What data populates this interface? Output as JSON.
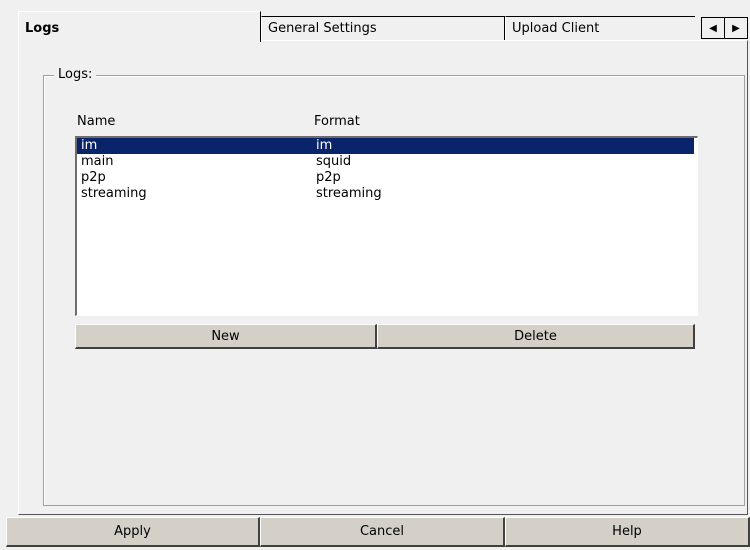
{
  "tabs": [
    {
      "label": "Logs",
      "active": true
    },
    {
      "label": "General Settings",
      "active": false
    },
    {
      "label": "Upload Client",
      "active": false
    }
  ],
  "tab_scroll": {
    "left": "◀",
    "right": "▶"
  },
  "group": {
    "label": "Logs:"
  },
  "columns": {
    "name": "Name",
    "format": "Format"
  },
  "rows": [
    {
      "name": "im",
      "format": "im",
      "selected": true
    },
    {
      "name": "main",
      "format": "squid"
    },
    {
      "name": "p2p",
      "format": "p2p"
    },
    {
      "name": "streaming",
      "format": "streaming"
    }
  ],
  "buttons": {
    "new": "New",
    "delete": "Delete"
  },
  "footer": {
    "apply": "Apply",
    "cancel": "Cancel",
    "help": "Help"
  },
  "colors": {
    "selection": "#0a246a",
    "face": "#f0f0f0",
    "button": "#d4d0c8"
  }
}
